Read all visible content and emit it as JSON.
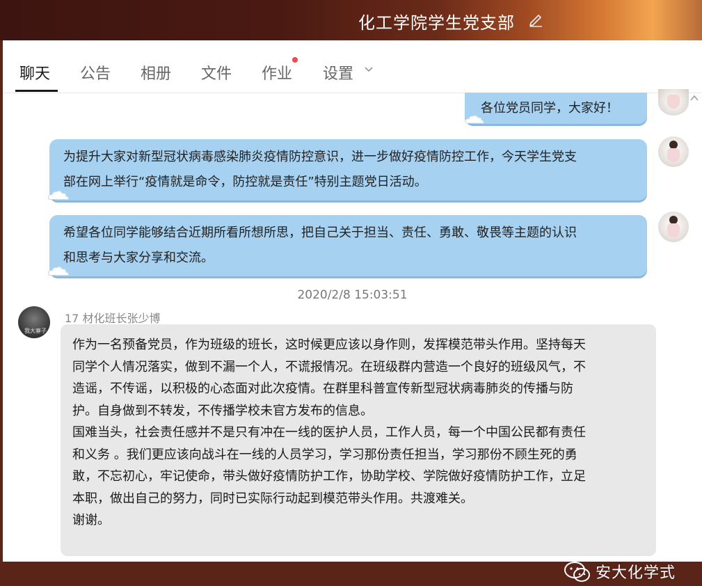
{
  "window": {
    "group_name": "化工学院学生党支部"
  },
  "tabs": [
    {
      "label": "聊天",
      "active": true
    },
    {
      "label": "公告"
    },
    {
      "label": "相册"
    },
    {
      "label": "文件"
    },
    {
      "label": "作业",
      "has_notification": true
    },
    {
      "label": "设置",
      "has_dropdown": true
    }
  ],
  "messages_me": [
    {
      "text": "各位党员同学，大家好！"
    },
    {
      "lines": [
        "为提升大家对新型冠状病毒感染肺炎疫情防控意识，进一步做好疫情防控工作，今天学生党支",
        "部在网上举行“疫情就是命令，防控就是责任”特别主题党日活动。"
      ]
    },
    {
      "lines": [
        "希望各位同学能够结合近期所看所想所思，把自己关于担当、责任、勇敢、敬畏等主题的认识",
        "和思考与大家分享和交流。"
      ]
    }
  ],
  "timestamp": "2020/2/8 15:03:51",
  "other_message": {
    "sender": "17 材化班长张少博",
    "avatar_text": "我大寨子",
    "lines": [
      "作为一名预备党员，作为班级的班长，这时候更应该以身作则，发挥模范带头作用。坚持每天",
      "同学个人情况落实，做到不漏一个人，不谎报情况。在班级群内营造一个良好的班级风气，不",
      "造谣，不传谣，以积极的心态面对此次疫情。在群里科普宣传新型冠状病毒肺炎的传播与防",
      "护。自身做到不转发，不传播学校未官方发布的信息。",
      "国难当头，社会责任感并不是只有冲在一线的医护人员，工作人员，每一个中国公民都有责任",
      "和义务 。我们更应该向战斗在一线的人员学习，学习那份责任担当，学习那份不顾生死的勇",
      "敢，不忘初心，牢记使命，带头做好疫情防护工作，协助学校、学院做好疫情防护工作，立足",
      "本职，做出自己的努力，同时已实际行动起到模范带头作用。共渡难关。",
      "谢谢。"
    ]
  },
  "watermark": {
    "text": "安大化学式",
    "icon": "wechat-icon"
  },
  "colors": {
    "bubble_me": "#a6d1f0",
    "bubble_other": "#e8e8e8",
    "notification_dot": "#f04a4a"
  }
}
